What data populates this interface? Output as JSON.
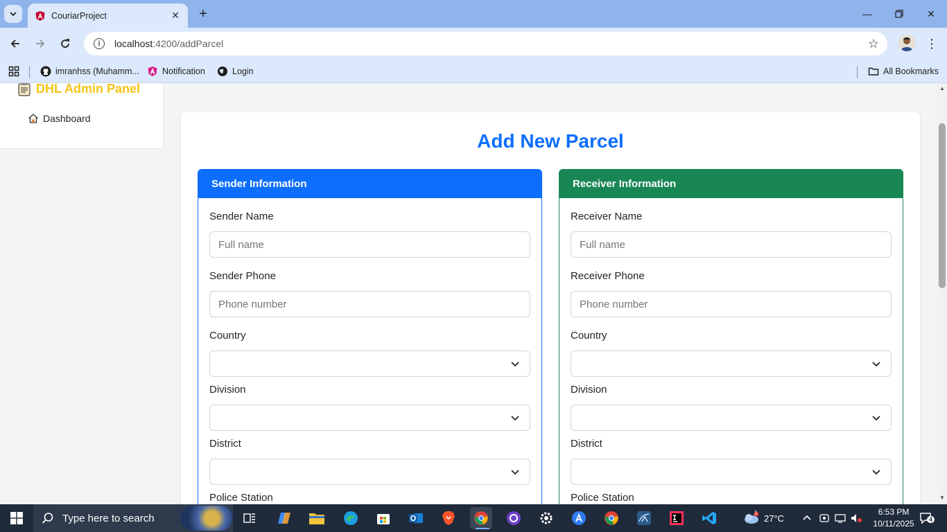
{
  "browser": {
    "tab_title": "CouriarProject",
    "url_host": "localhost",
    "url_rest": ":4200/addParcel",
    "bookmarks": [
      {
        "label": "imranhss (Muhamm..."
      },
      {
        "label": "Notification"
      },
      {
        "label": "Login"
      }
    ],
    "all_bookmarks": "All Bookmarks"
  },
  "sidebar": {
    "brand": "DHL Admin Panel",
    "nav": [
      {
        "label": "Dashboard"
      }
    ]
  },
  "form": {
    "title": "Add New Parcel",
    "sender": {
      "heading": "Sender Information",
      "color": "#0d6efd",
      "name_label": "Sender Name",
      "name_placeholder": "Full name",
      "phone_label": "Sender Phone",
      "phone_placeholder": "Phone number",
      "country_label": "Country",
      "division_label": "Division",
      "district_label": "District",
      "police_label": "Police Station"
    },
    "receiver": {
      "heading": "Receiver Information",
      "color": "#198754",
      "name_label": "Receiver Name",
      "name_placeholder": "Full name",
      "phone_label": "Receiver Phone",
      "phone_placeholder": "Phone number",
      "country_label": "Country",
      "division_label": "Division",
      "district_label": "District",
      "police_label": "Police Station"
    }
  },
  "taskbar": {
    "search_placeholder": "Type here to search",
    "weather": "27°C",
    "weather_badge": "1",
    "time": "6:53 PM",
    "date": "10/11/2025",
    "notifications": "4"
  }
}
